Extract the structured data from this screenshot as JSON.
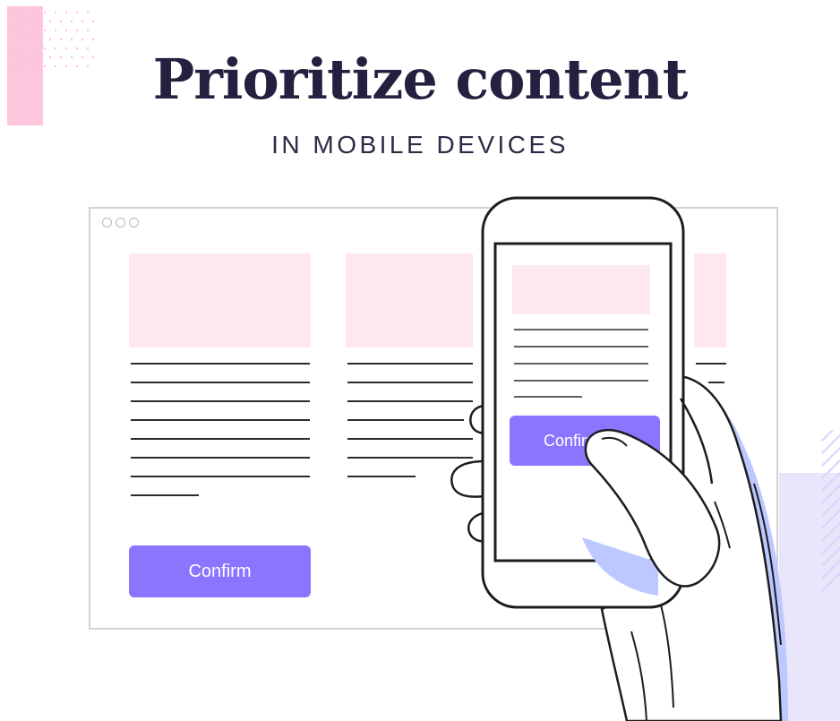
{
  "header": {
    "title": "Prioritize content",
    "subtitle": "IN MOBILE DEVICES"
  },
  "desktop": {
    "confirm_label": "Confirm"
  },
  "phone": {
    "confirm_label": "Confirm"
  },
  "colors": {
    "accent": "#8b75ff",
    "pink": "#fde7f1",
    "text_dark": "#23213f",
    "hand_shadow": "#bcc8ff",
    "lavender": "#e7e5fb"
  },
  "icons": [
    "window-dots-icon",
    "hand-illustration",
    "smartphone-illustration"
  ]
}
